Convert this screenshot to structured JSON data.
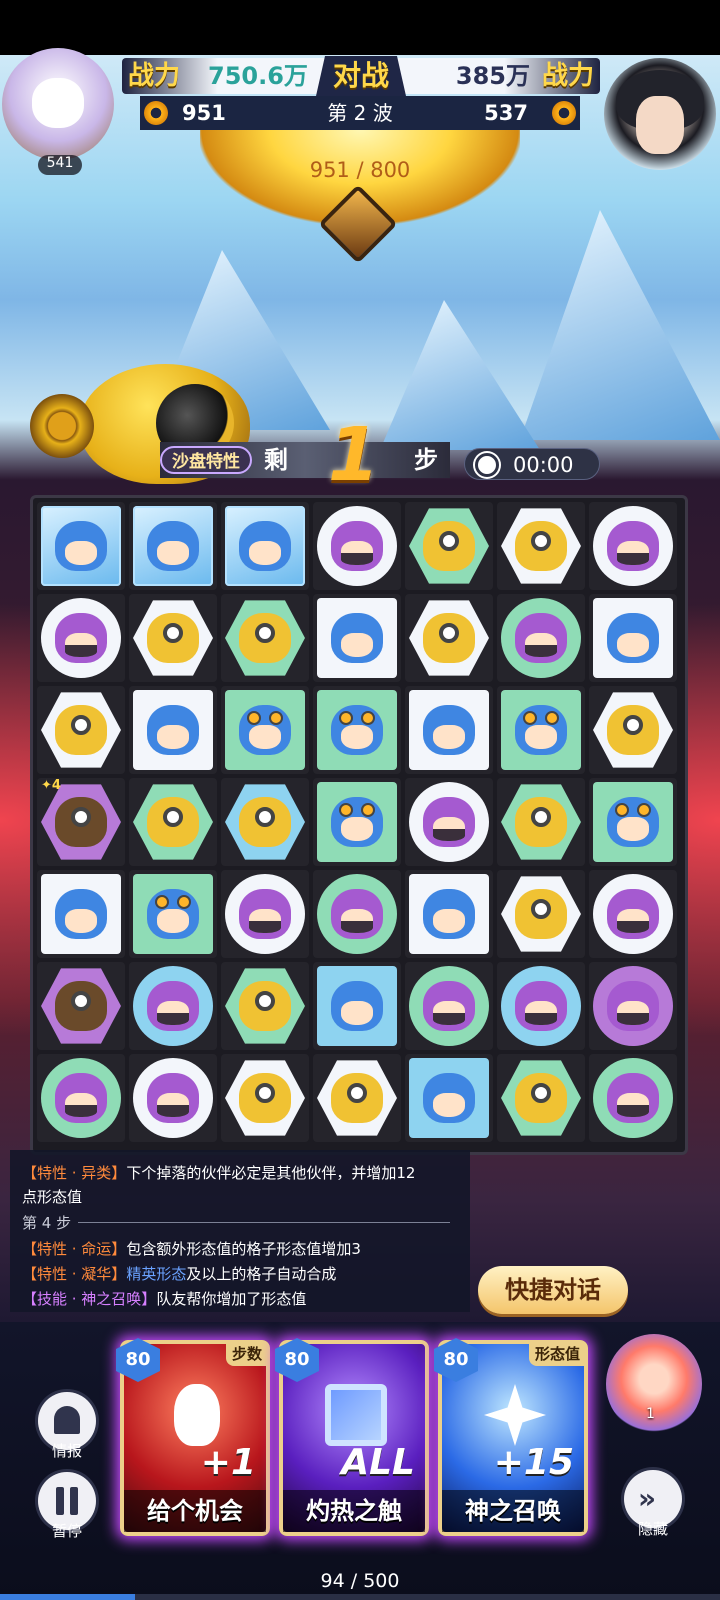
{
  "header": {
    "left_player": {
      "power_label": "战力",
      "power_value": "750.6万",
      "score": "951",
      "level": "541"
    },
    "vs_label": "对战",
    "right_player": {
      "power_label": "战力",
      "power_value": "385万",
      "score": "537"
    },
    "wave_label": "第 2 波",
    "progress_text": "951 / 800"
  },
  "steps": {
    "trait_badge": "沙盘特性",
    "remain_label": "剩",
    "count": "1",
    "unit": "步",
    "timer": "00:00"
  },
  "board": {
    "rows": [
      [
        {
          "bg": "frozen",
          "shape": "square",
          "char": "blue"
        },
        {
          "bg": "frozen",
          "shape": "square",
          "char": "blue"
        },
        {
          "bg": "frozen",
          "shape": "square",
          "char": "blue"
        },
        {
          "bg": "white",
          "shape": "circle",
          "char": "purple"
        },
        {
          "bg": "green",
          "shape": "hex",
          "char": "yellow"
        },
        {
          "bg": "white",
          "shape": "hex",
          "char": "yellow"
        },
        {
          "bg": "white",
          "shape": "circle",
          "char": "purple"
        }
      ],
      [
        {
          "bg": "white",
          "shape": "circle",
          "char": "purple"
        },
        {
          "bg": "white",
          "shape": "hex",
          "char": "yellow"
        },
        {
          "bg": "green",
          "shape": "hex",
          "char": "yellow"
        },
        {
          "bg": "white",
          "shape": "square",
          "char": "blue"
        },
        {
          "bg": "white",
          "shape": "hex",
          "char": "yellow"
        },
        {
          "bg": "green",
          "shape": "circle",
          "char": "purple"
        },
        {
          "bg": "white",
          "shape": "square",
          "char": "blue"
        }
      ],
      [
        {
          "bg": "white",
          "shape": "hex",
          "char": "yellow"
        },
        {
          "bg": "white",
          "shape": "square",
          "char": "blue"
        },
        {
          "bg": "green",
          "shape": "square",
          "char": "blue"
        },
        {
          "bg": "green",
          "shape": "square",
          "char": "blue"
        },
        {
          "bg": "white",
          "shape": "square",
          "char": "blue"
        },
        {
          "bg": "green",
          "shape": "square",
          "char": "blue"
        },
        {
          "bg": "white",
          "shape": "hex",
          "char": "yellow"
        }
      ],
      [
        {
          "bg": "purple",
          "shape": "hex",
          "char": "darkgold",
          "badge": "4"
        },
        {
          "bg": "green",
          "shape": "hex",
          "char": "yellow"
        },
        {
          "bg": "blue",
          "shape": "hex",
          "char": "yellow"
        },
        {
          "bg": "green",
          "shape": "square",
          "char": "blue"
        },
        {
          "bg": "white",
          "shape": "circle",
          "char": "purple"
        },
        {
          "bg": "green",
          "shape": "hex",
          "char": "yellow"
        },
        {
          "bg": "green",
          "shape": "square",
          "char": "blue"
        }
      ],
      [
        {
          "bg": "white",
          "shape": "square",
          "char": "blue"
        },
        {
          "bg": "green",
          "shape": "square",
          "char": "blue"
        },
        {
          "bg": "white",
          "shape": "circle",
          "char": "purple"
        },
        {
          "bg": "green",
          "shape": "circle",
          "char": "purple"
        },
        {
          "bg": "white",
          "shape": "square",
          "char": "blue"
        },
        {
          "bg": "white",
          "shape": "hex",
          "char": "yellow"
        },
        {
          "bg": "white",
          "shape": "circle",
          "char": "purple"
        }
      ],
      [
        {
          "bg": "purple",
          "shape": "hex",
          "char": "darkgold"
        },
        {
          "bg": "blue",
          "shape": "circle",
          "char": "purple"
        },
        {
          "bg": "green",
          "shape": "hex",
          "char": "yellow"
        },
        {
          "bg": "blue",
          "shape": "square",
          "char": "blue"
        },
        {
          "bg": "green",
          "shape": "circle",
          "char": "purple"
        },
        {
          "bg": "blue",
          "shape": "circle",
          "char": "purple"
        },
        {
          "bg": "purple",
          "shape": "circle",
          "char": "purple"
        }
      ],
      [
        {
          "bg": "green",
          "shape": "circle",
          "char": "purple"
        },
        {
          "bg": "white",
          "shape": "circle",
          "char": "purple"
        },
        {
          "bg": "white",
          "shape": "hex",
          "char": "yellow"
        },
        {
          "bg": "white",
          "shape": "hex",
          "char": "yellow"
        },
        {
          "bg": "blue",
          "shape": "square",
          "char": "blue"
        },
        {
          "bg": "green",
          "shape": "hex",
          "char": "yellow"
        },
        {
          "bg": "green",
          "shape": "circle",
          "char": "purple"
        }
      ]
    ]
  },
  "log": {
    "line1_tag": "【特性 · 异类】",
    "line1_text": "下个掉落的伙伴必定是其他伙伴，并增加12",
    "line1_cont": "点形态值",
    "step_header": "第 4 步",
    "line2_tag": "【特性 · 命运】",
    "line2_text": "包含额外形态值的格子形态值增加3",
    "line3_tag": "【特性 · 凝华】",
    "line3_highlight": "精英形态",
    "line3_text": "及以上的格子自动合成",
    "line4_tag": "【技能 · 神之召唤】",
    "line4_text": "队友帮你增加了形态值"
  },
  "quick_chat_label": "快捷对话",
  "controls": {
    "info_label": "情报",
    "pause_label": "暂停",
    "hide_label": "隐藏"
  },
  "cards": [
    {
      "cost": "80",
      "tag": "步数",
      "big": "+1",
      "name": "给个机会"
    },
    {
      "cost": "80",
      "tag": "",
      "big": "ALL",
      "name": "灼热之触"
    },
    {
      "cost": "80",
      "tag": "形态值",
      "big": "+15",
      "name": "神之召唤"
    }
  ],
  "helper_count": "1",
  "energy": {
    "text": "94 / 500",
    "current": 94,
    "max": 500
  },
  "colors": {
    "accent_gold": "#ffd84a",
    "card_glow": "#c64bff",
    "energy": "#3a7ee0"
  }
}
